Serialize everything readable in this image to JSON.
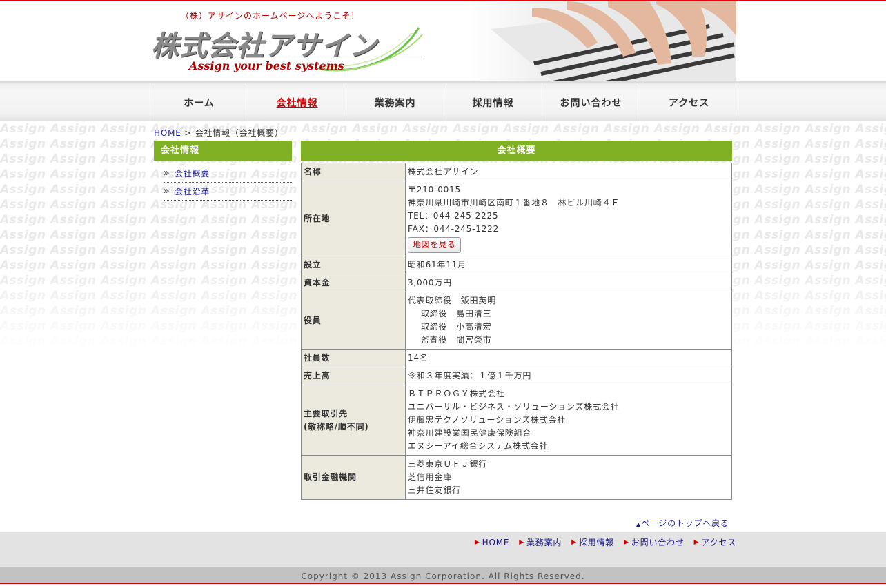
{
  "header": {
    "tagline": "（株）アサインのホームページへようこそ！",
    "logo_main": "株式会社アサイン",
    "logo_sub": "Assign your best systems"
  },
  "background_word": "Assign",
  "nav": {
    "items": [
      "ホーム",
      "会社情報",
      "業務案内",
      "採用情報",
      "お問い合わせ",
      "アクセス"
    ],
    "active_index": 1
  },
  "breadcrumb": {
    "home": "HOME",
    "separator": " > ",
    "current": "会社情報（会社概要）"
  },
  "sidebar": {
    "title": "会社情報",
    "items": [
      "会社概要",
      "会社沿革"
    ]
  },
  "main": {
    "title": "会社概要",
    "rows": [
      {
        "label": "名称",
        "lines": [
          "株式会社アサイン"
        ]
      },
      {
        "label": "所在地",
        "lines": [
          "〒210-0015",
          "神奈川県川崎市川崎区南町１番地８　林ビル川崎４Ｆ",
          "TEL：044-245-2225",
          "FAX：044-245-1222"
        ]
      },
      {
        "label": "設立",
        "lines": [
          "昭和61年11月"
        ]
      },
      {
        "label": "資本金",
        "lines": [
          "3,000万円"
        ]
      },
      {
        "label": "役員",
        "lines": [
          "代表取締役　飯田英明",
          "取締役　島田清三",
          "取締役　小高清宏",
          "監査役　間宮榮市"
        ]
      },
      {
        "label": "社員数",
        "lines": [
          "14名"
        ]
      },
      {
        "label": "売上高",
        "lines": [
          "令和３年度実績：１億１千万円"
        ]
      },
      {
        "label": "主要取引先",
        "label2": "(敬称略/順不同)",
        "lines": [
          "ＢＩＰＲＯＧＹ株式会社",
          "ユニバーサル・ビジネス・ソリューションズ株式会社",
          "伊藤忠テクノソリューションズ株式会社",
          "神奈川建設業国民健康保険組合",
          "エヌシーアイ総合システム株式会社"
        ]
      },
      {
        "label": "取引金融機関",
        "lines": [
          "三菱東京ＵＦＪ銀行",
          "芝信用金庫",
          "三井住友銀行"
        ]
      }
    ],
    "map_button": "地図を見る"
  },
  "pagetop": "ページのトップへ戻る",
  "footer": {
    "links": [
      "HOME",
      "業務案内",
      "採用情報",
      "お問い合わせ",
      "アクセス"
    ],
    "copyright": "Copyright © 2013 Assign Corporation. All Rights Reserved."
  },
  "colors": {
    "accent_green": "#80b124",
    "accent_red": "#e60012",
    "link_blue": "#1a1a8c",
    "label_bg": "#ece9df"
  }
}
